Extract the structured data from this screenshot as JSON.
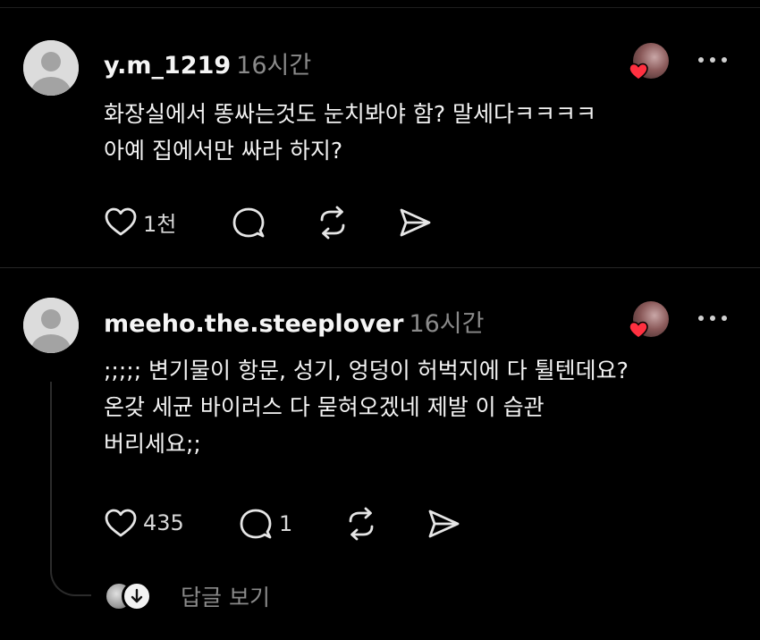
{
  "posts": [
    {
      "username": "y.m_1219",
      "time": "16시간",
      "text": "화장실에서 똥싸는것도 눈치봐야 함? 말세다ㅋㅋㅋㅋ\n아예 집에서만 싸라 하지?",
      "likes": "1천",
      "replies": ""
    },
    {
      "username": "meeho.the.steeplover",
      "time": "16시간",
      "text": ";;;;; 변기물이 항문, 성기, 엉덩이 허벅지에 다 튈텐데요?\n온갖 세균 바이러스 다 묻혀오겠네 제발 이 습관\n버리세요;;",
      "likes": "435",
      "replies": "1"
    }
  ],
  "thread": {
    "view_replies_label": "답글 보기"
  },
  "icons": {
    "like": "heart-icon",
    "reply": "comment-icon",
    "repost": "repost-icon",
    "share": "send-icon",
    "more": "more-horizontal-icon",
    "liked_badge": "red-heart-icon",
    "expand": "arrow-down-icon"
  },
  "colors": {
    "background": "#000000",
    "text": "#f3f3f3",
    "muted": "#8a8a8a",
    "heart_red": "#ff3040"
  }
}
